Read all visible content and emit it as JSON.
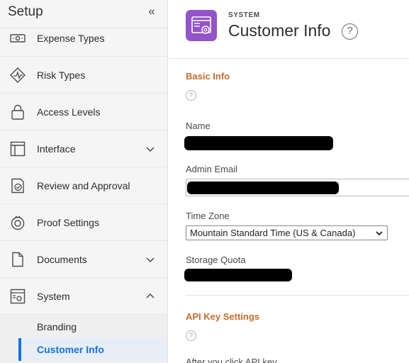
{
  "sidebar": {
    "title": "Setup",
    "collapse_icon": "double-chevron-left-icon",
    "items": [
      {
        "label": "Expense Types",
        "icon": "money-icon"
      },
      {
        "label": "Risk Types",
        "icon": "risk-icon"
      },
      {
        "label": "Access Levels",
        "icon": "lock-icon"
      },
      {
        "label": "Interface",
        "icon": "layout-icon",
        "expandable": true
      },
      {
        "label": "Review and Approval",
        "icon": "review-icon"
      },
      {
        "label": "Proof Settings",
        "icon": "proof-icon"
      },
      {
        "label": "Documents",
        "icon": "document-icon",
        "expandable": true
      },
      {
        "label": "System",
        "icon": "system-icon",
        "expanded": true
      }
    ],
    "sub_items": [
      {
        "label": "Branding"
      },
      {
        "label": "Customer Info",
        "active": true
      }
    ]
  },
  "header": {
    "eyebrow": "SYSTEM",
    "title": "Customer Info",
    "help_label": "?"
  },
  "basic_info": {
    "title": "Basic Info",
    "help_label": "?",
    "name_label": "Name",
    "admin_email_label": "Admin Email",
    "time_zone_label": "Time Zone",
    "time_zone_value": "Mountain Standard Time (US & Canada)",
    "storage_quota_label": "Storage Quota"
  },
  "api_key": {
    "title": "API Key Settings",
    "help_label": "?",
    "truncated_text": "After you click API key..."
  },
  "colors": {
    "accent": "#1473e6",
    "section_title": "#c56e2b",
    "app_icon": "#9254c8"
  }
}
